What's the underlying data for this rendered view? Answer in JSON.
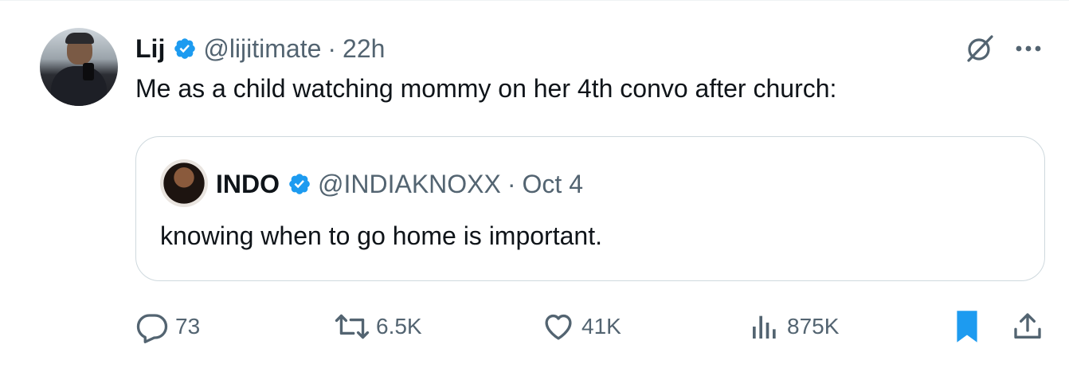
{
  "tweet": {
    "author_name": "Lij",
    "author_handle": "@lijitimate",
    "separator": "·",
    "time": "22h",
    "text": "Me as a child watching mommy on her 4th convo after church:"
  },
  "quote": {
    "author_name": "INDO",
    "author_handle": "@INDIAKNOXX",
    "separator": "·",
    "date": "Oct 4",
    "text": "knowing when to go home is important."
  },
  "actions": {
    "replies": "73",
    "reposts": "6.5K",
    "likes": "41K",
    "views": "875K"
  },
  "icons": {
    "verified": "verified-badge-icon",
    "grok": "grok-icon",
    "more": "more-icon",
    "reply": "reply-icon",
    "repost": "repost-icon",
    "like": "heart-icon",
    "views": "views-icon",
    "bookmark": "bookmark-icon",
    "share": "share-icon"
  },
  "colors": {
    "verified": "#1d9bf0",
    "bookmark_active": "#1d9bf0",
    "secondary_text": "#536471",
    "primary_text": "#0f1419",
    "border": "#cfd9de"
  }
}
